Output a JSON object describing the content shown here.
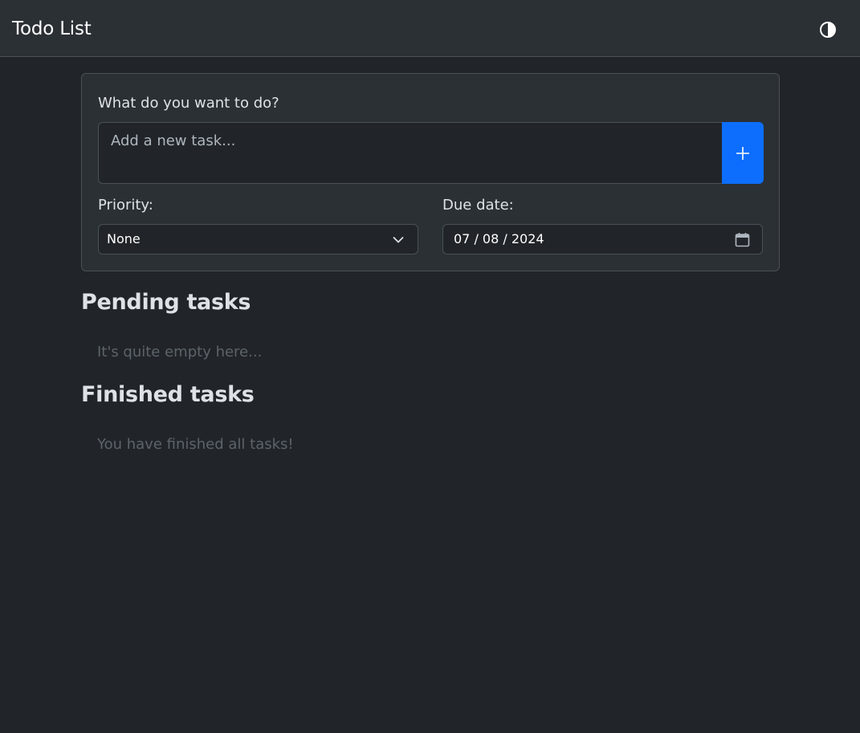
{
  "header": {
    "title": "Todo List",
    "theme_toggle_icon": "contrast-icon"
  },
  "form": {
    "task_label": "What do you want to do?",
    "task_placeholder": "Add a new task...",
    "task_value": "",
    "add_icon": "plus-icon",
    "priority_label": "Priority:",
    "priority_value": "None",
    "due_date_label": "Due date:",
    "due_date_value": "07 / 08 / 2024",
    "due_date_icon": "calendar-icon"
  },
  "sections": {
    "pending_title": "Pending tasks",
    "pending_empty": "It's quite empty here...",
    "finished_title": "Finished tasks",
    "finished_empty": "You have finished all tasks!"
  },
  "colors": {
    "background": "#212529",
    "surface": "#2b3035",
    "border": "#495057",
    "accent": "#0d6efd",
    "text": "#dee2e6",
    "muted": "#5c636a"
  }
}
